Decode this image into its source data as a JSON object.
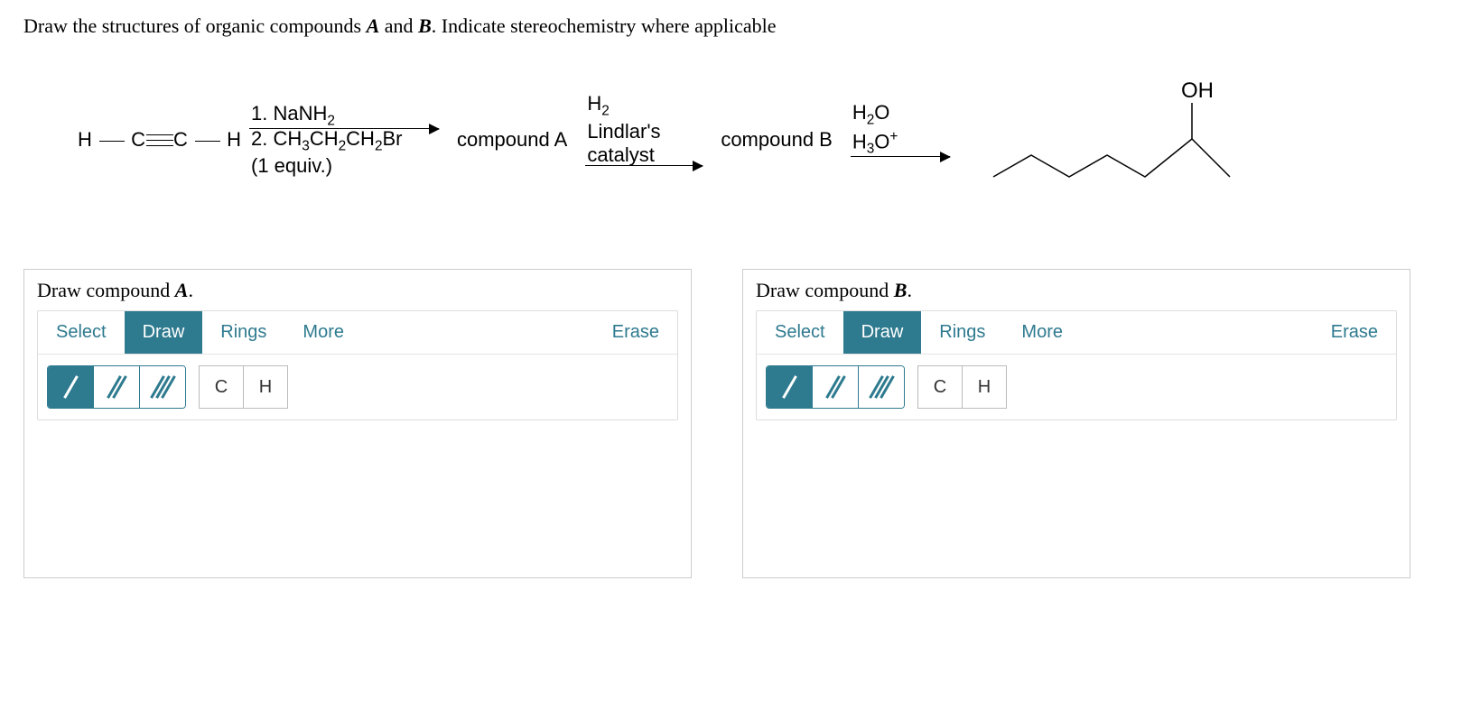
{
  "question": {
    "prefix": "Draw the structures of organic compounds ",
    "mid1": " and ",
    "suffix": ". Indicate stereochemistry where applicable",
    "A": "A",
    "B": "B"
  },
  "scheme": {
    "start": "H—C≡C—H",
    "step1_top": "1. NaNH",
    "step1_top_sub": "2",
    "step1_bot_a": "2. CH",
    "step1_bot_b": "CH",
    "step1_bot_c": "CH",
    "step1_bot_d": "Br",
    "step1_bot2": "(1 equiv.)",
    "compA": "compound A",
    "step2_a": "H",
    "step2_b": "Lindlar's",
    "step2_c": "catalyst",
    "compB": "compound B",
    "step3_a": "H",
    "step3_a2": "O",
    "step3_b": "H",
    "step3_b2": "O",
    "product_label": "OH"
  },
  "panelA": {
    "title_pre": "Draw compound ",
    "title_em": "A",
    "title_post": ".",
    "tabs": {
      "select": "Select",
      "draw": "Draw",
      "rings": "Rings",
      "more": "More",
      "erase": "Erase"
    },
    "atoms": {
      "c": "C",
      "h": "H"
    }
  },
  "panelB": {
    "title_pre": "Draw compound ",
    "title_em": "B",
    "title_post": ".",
    "tabs": {
      "select": "Select",
      "draw": "Draw",
      "rings": "Rings",
      "more": "More",
      "erase": "Erase"
    },
    "atoms": {
      "c": "C",
      "h": "H"
    }
  }
}
